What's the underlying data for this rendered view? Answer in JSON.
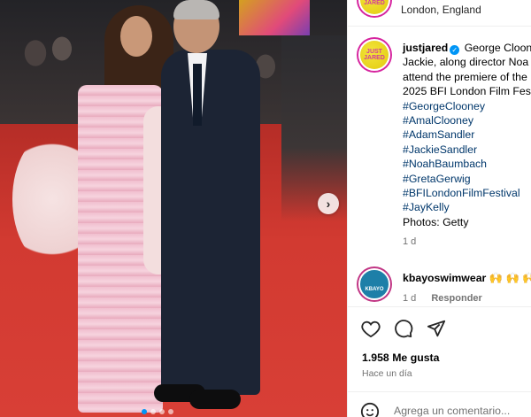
{
  "photo": {
    "alt": "",
    "carousel": {
      "total": 4,
      "active": 0
    }
  },
  "post": {
    "location": "London, England",
    "avatar_text": "JUST JARED",
    "author": "justjared",
    "caption_lines": [
      "George Cloon",
      "Jackie, along director Noa",
      "attend the premiere of the",
      "2025 BFI London Film Fest"
    ],
    "hashtags": [
      "#GeorgeClooney",
      "#AmalClooney",
      "#AdamSandler",
      "#JackieSandler",
      "#NoahBaumbach",
      "#GretaGerwig",
      "#BFILondonFilmFestival",
      "#JayKelly"
    ],
    "photos_credit": "Photos: Getty",
    "time_ago": "1 d"
  },
  "comment": {
    "avatar_text": "KBAYO",
    "user": "kbayoswimwear",
    "text": "🙌 🙌 🙌",
    "time_ago": "1 d",
    "reply_label": "Responder"
  },
  "actions": {
    "like_icon": "heart-outline-icon",
    "comment_icon": "comment-bubble-icon",
    "share_icon": "paper-plane-icon",
    "likes": "1.958 Me gusta",
    "posted": "Hace un día"
  },
  "add_comment": {
    "placeholder": "Agrega un comentario..."
  },
  "colors": {
    "link": "#00376b",
    "muted": "#737373",
    "verified": "#0095f6"
  }
}
